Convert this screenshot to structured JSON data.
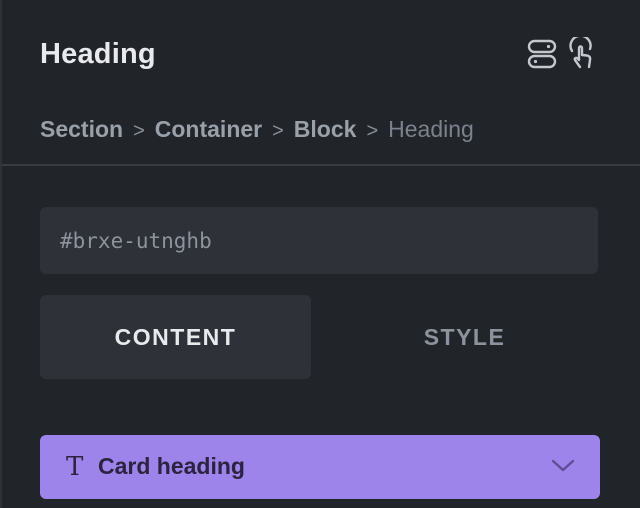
{
  "panel": {
    "title": "Heading",
    "icons": {
      "structure": "structure-icon",
      "pointer": "pointer-hand-icon"
    }
  },
  "breadcrumb": {
    "items": [
      "Section",
      "Container",
      "Block",
      "Heading"
    ],
    "separator": ">"
  },
  "element_id": {
    "value": "#brxe-utnghb"
  },
  "tabs": {
    "content_label": "CONTENT",
    "style_label": "STYLE",
    "active": "CONTENT"
  },
  "accordion": {
    "icon_glyph": "T",
    "label": "Card heading",
    "expanded": false
  },
  "colors": {
    "background": "#212429",
    "field_background": "#2e3138",
    "accent": "#9c84ea",
    "accent_text": "#2b2340",
    "text_primary": "#e8eaed",
    "text_muted": "#8d939c"
  }
}
